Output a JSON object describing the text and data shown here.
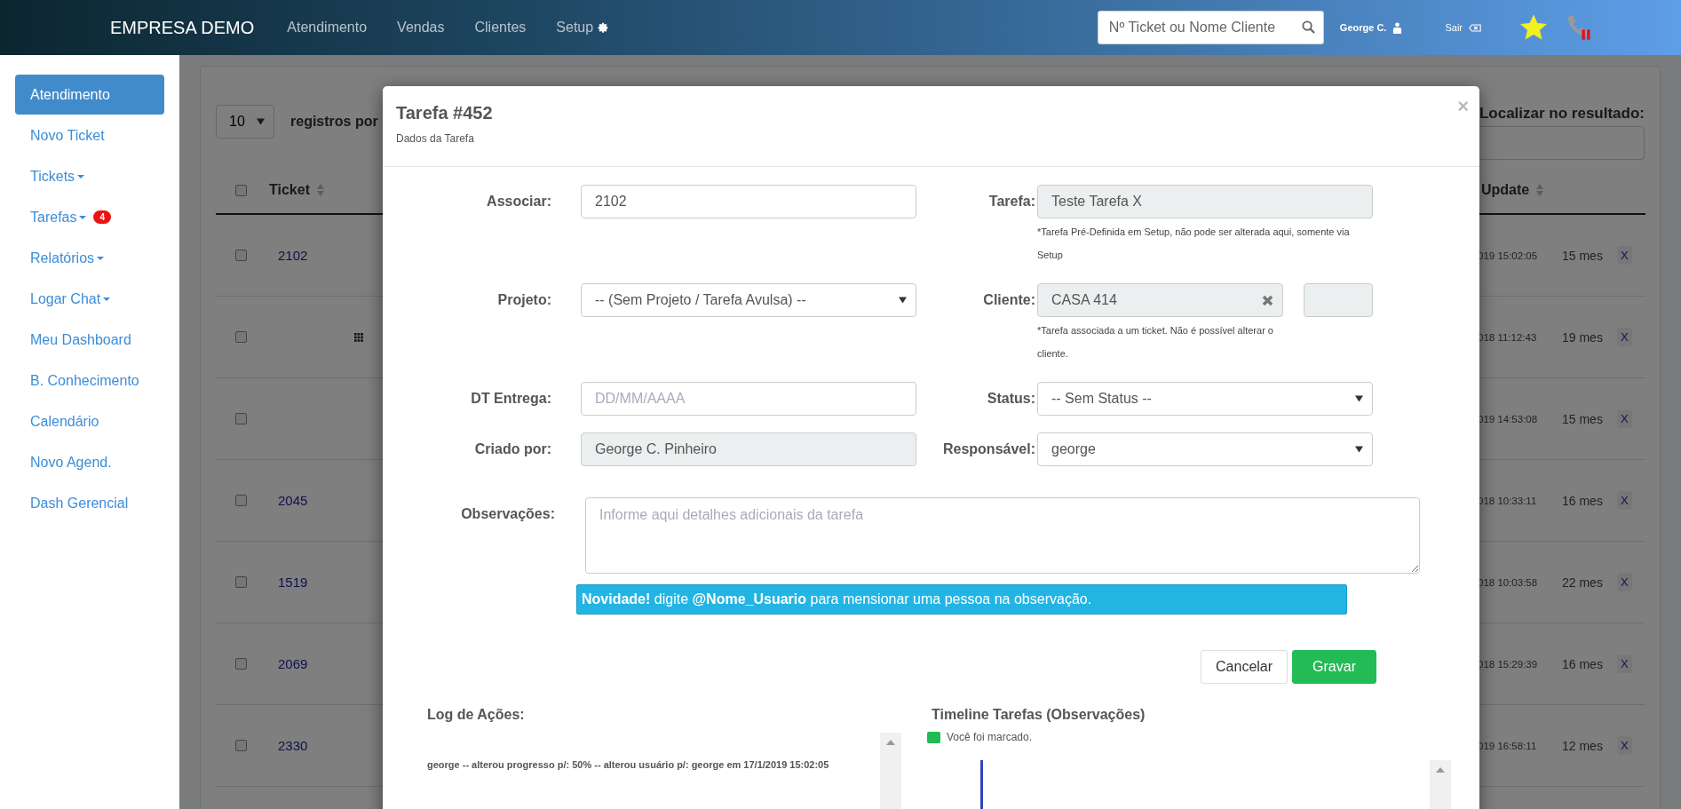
{
  "topbar": {
    "brand": "EMPRESA DEMO",
    "nav": [
      {
        "label": "Atendimento",
        "kind": "text"
      },
      {
        "label": "Vendas",
        "kind": "text"
      },
      {
        "label": "Clientes",
        "kind": "text"
      },
      {
        "label": "Setup",
        "kind": "gear"
      }
    ],
    "search": {
      "placeholder": "Nº Ticket ou Nome Cliente"
    },
    "user": "George C.",
    "logout": "Sair"
  },
  "sidebar": {
    "items": [
      {
        "label": "Atendimento",
        "selected": true,
        "dropdown": false
      },
      {
        "label": "Novo Ticket",
        "selected": false,
        "dropdown": false
      },
      {
        "label": "Tickets",
        "selected": false,
        "dropdown": true
      },
      {
        "label": "Tarefas",
        "selected": false,
        "dropdown": true,
        "badge": "4"
      },
      {
        "label": "Relatórios",
        "selected": false,
        "dropdown": true
      },
      {
        "label": "Logar Chat",
        "selected": false,
        "dropdown": true
      },
      {
        "label": "Meu Dashboard",
        "selected": false,
        "dropdown": false
      },
      {
        "label": "B. Conhecimento",
        "selected": false,
        "dropdown": false
      },
      {
        "label": "Calendário",
        "selected": false,
        "dropdown": false
      },
      {
        "label": "Novo Agend.",
        "selected": false,
        "dropdown": false
      },
      {
        "label": "Dash Gerencial",
        "selected": false,
        "dropdown": false
      }
    ]
  },
  "table": {
    "page_length": "10",
    "length_label": "registros por",
    "select_all_checked": false,
    "search_label": "Localizar no resultado:",
    "columns": [
      "Ticket",
      "Update"
    ],
    "rows": [
      {
        "kind": "plain",
        "checked": false,
        "ticket": "2102",
        "date": "019 15:02:05",
        "age": "15 mes",
        "action": "X"
      },
      {
        "kind": "menu",
        "checked": false,
        "ticket": "",
        "date": "018 11:12:43",
        "age": "19 mes",
        "action": "X"
      },
      {
        "kind": "plain",
        "checked": false,
        "ticket": "",
        "date": "019 14:53:08",
        "age": "15 mes",
        "action": "X"
      },
      {
        "kind": "plain",
        "checked": false,
        "ticket": "2045",
        "date": "018 10:33:11",
        "age": "16 mes",
        "action": "X"
      },
      {
        "kind": "plain",
        "checked": false,
        "ticket": "1519",
        "date": "018 10:03:58",
        "age": "22 mes",
        "action": "X"
      },
      {
        "kind": "plain",
        "checked": false,
        "ticket": "2069",
        "date": "018 15:29:39",
        "age": "16 mes",
        "action": "X"
      },
      {
        "kind": "plain",
        "checked": false,
        "ticket": "2330",
        "date": "019 16:58:11",
        "age": "12 mes",
        "action": "X"
      }
    ]
  },
  "modal": {
    "title": "Tarefa #452",
    "subtitle": "Dados da Tarefa",
    "close": "×",
    "rows": [
      {
        "left": {
          "label": "Associar:",
          "kind": "input",
          "value": "2102"
        },
        "right": {
          "label": "Tarefa:",
          "kind": "readonly",
          "value": "Teste Tarefa X",
          "hint": "*Tarefa Pré-Definida em Setup, não pode ser alterada aqui, somente via Setup"
        }
      },
      {
        "left": {
          "label": "Projeto:",
          "kind": "select",
          "value": "-- (Sem Projeto / Tarefa Avulsa) --"
        },
        "right": {
          "label": "Cliente:",
          "kind": "clearable",
          "value": "CASA 414",
          "hint": "*Tarefa associada a um ticket. Não é possível alterar o cliente."
        }
      },
      {
        "left": {
          "label": "DT Entrega:",
          "kind": "input",
          "placeholder": "DD/MM/AAAA"
        },
        "right": {
          "label": "Status:",
          "kind": "select",
          "value": "-- Sem Status --"
        }
      },
      {
        "left": {
          "label": "Criado por:",
          "kind": "readonly",
          "value": "George C. Pinheiro"
        },
        "right": {
          "label": "Responsável:",
          "kind": "select",
          "value": "george"
        }
      }
    ],
    "notes": {
      "label": "Observações:",
      "placeholder": "Informe aqui detalhes adicionais da tarefa"
    },
    "notice": "**Novidade!** digite **@Nome_Usuario** para mensionar uma pessoa na observação.",
    "buttons": [
      {
        "label": "Cancelar",
        "kind": "default"
      },
      {
        "label": "Gravar",
        "kind": "primary"
      }
    ],
    "log": {
      "title": "Log de Ações:",
      "entries": [
        "george -- alterou progresso p/: 50% -- alterou usuário p/: george em 17/1/2019 15:02:05"
      ]
    },
    "timeline": {
      "title": "Timeline Tarefas (Observações)",
      "legend": [
        {
          "label": "Você foi marcado.",
          "color": "#22bb55"
        }
      ]
    }
  }
}
